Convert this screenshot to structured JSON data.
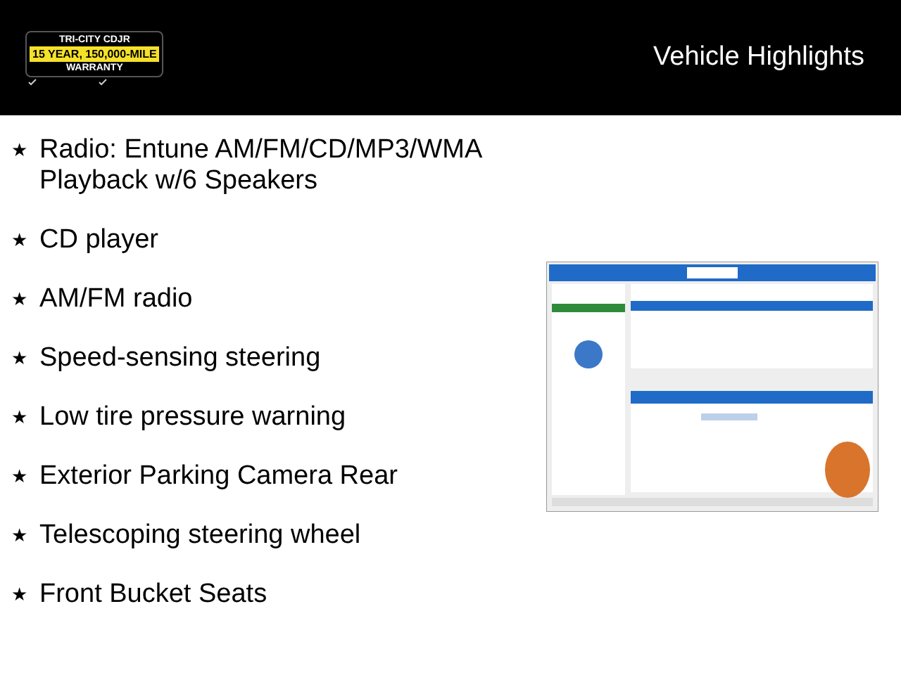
{
  "header": {
    "logo": {
      "line_1": "TRI-CITY CDJR",
      "line_2": "15 YEAR, 150,000-MILE",
      "line_3": "WARRANTY"
    },
    "title": "Vehicle Highlights"
  },
  "highlights": [
    {
      "bullet": "★",
      "text": "Radio: Entune AM/FM/CD/MP3/WMA Playback w/6 Speakers"
    },
    {
      "bullet": "★",
      "text": "CD player"
    },
    {
      "bullet": "★",
      "text": "AM/FM radio"
    },
    {
      "bullet": "★",
      "text": "Speed-sensing steering"
    },
    {
      "bullet": "★",
      "text": "Low tire pressure warning"
    },
    {
      "bullet": "★",
      "text": "Exterior Parking Camera Rear"
    },
    {
      "bullet": "★",
      "text": "Telescoping steering wheel"
    },
    {
      "bullet": "★",
      "text": "Front Bucket Seats"
    }
  ]
}
